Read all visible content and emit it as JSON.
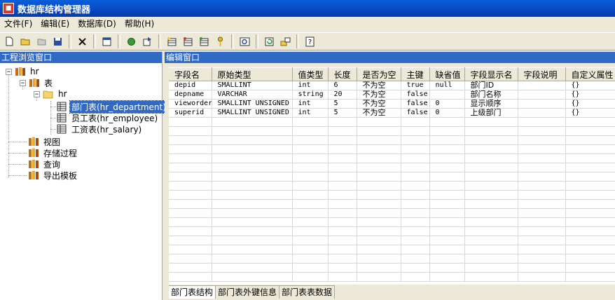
{
  "window": {
    "title": "数据库结构管理器"
  },
  "menu": [
    {
      "label": "文件(F)"
    },
    {
      "label": "编辑(E)"
    },
    {
      "label": "数据库(D)"
    },
    {
      "label": "帮助(H)"
    }
  ],
  "toolbar": {
    "groups": [
      [
        "new-file-icon",
        "open-folder-icon",
        "close-file-icon",
        "save-icon"
      ],
      [
        "delete-icon"
      ],
      [
        "properties-icon"
      ],
      [
        "recycle-icon",
        "export-icon"
      ],
      [
        "new-table-icon",
        "edit-table-icon",
        "table-index-icon",
        "key-icon"
      ],
      [
        "preview-icon"
      ],
      [
        "refresh-icon",
        "connect-icon"
      ],
      [
        "help-icon"
      ]
    ]
  },
  "left_pane": {
    "title": "工程浏览窗口",
    "tree": {
      "root": "hr",
      "tables_label": "表",
      "schema_label": "hr",
      "tables": [
        {
          "label": "部门表(hr_department)",
          "selected": true
        },
        {
          "label": "员工表(hr_employee)",
          "selected": false
        },
        {
          "label": "工资表(hr_salary)",
          "selected": false
        }
      ],
      "others": [
        "视图",
        "存储过程",
        "查询",
        "导出模板"
      ]
    }
  },
  "editor": {
    "title": "编辑窗口",
    "columns": [
      "字段名",
      "原始类型",
      "值类型",
      "长度",
      "是否为空",
      "主键",
      "缺省值",
      "字段显示名",
      "字段说明",
      "自定义属性"
    ],
    "rows": [
      [
        "depid",
        "SMALLINT",
        "int",
        "6",
        "不为空",
        "true",
        "null",
        "部门ID",
        "",
        "{}"
      ],
      [
        "depname",
        "VARCHAR",
        "string",
        "20",
        "不为空",
        "false",
        "",
        "部门名称",
        "",
        "{}"
      ],
      [
        "vieworder",
        "SMALLINT UNSIGNED",
        "int",
        "5",
        "不为空",
        "false",
        "0",
        "显示顺序",
        "",
        "{}"
      ],
      [
        "superid",
        "SMALLINT UNSIGNED",
        "int",
        "5",
        "不为空",
        "false",
        "0",
        "上级部门",
        "",
        "{}"
      ]
    ],
    "tabs": [
      {
        "label": "部门表结构",
        "active": true
      },
      {
        "label": "部门表外键信息",
        "active": false
      },
      {
        "label": "部门表表数据",
        "active": false
      }
    ]
  }
}
